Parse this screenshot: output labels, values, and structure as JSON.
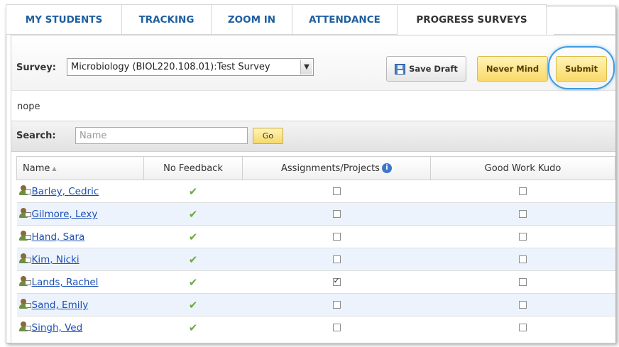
{
  "tabs": [
    {
      "label": "MY STUDENTS",
      "active": false
    },
    {
      "label": "TRACKING",
      "active": false
    },
    {
      "label": "ZOOM IN",
      "active": false
    },
    {
      "label": "ATTENDANCE",
      "active": false
    },
    {
      "label": "PROGRESS SURVEYS",
      "active": true
    }
  ],
  "survey": {
    "label": "Survey:",
    "selected": "Microbiology (BIOL220.108.01):Test Survey"
  },
  "buttons": {
    "save_draft": "Save Draft",
    "never_mind": "Never Mind",
    "submit": "Submit"
  },
  "status_text": "nope",
  "search": {
    "label": "Search:",
    "placeholder": "Name",
    "go_label": "Go"
  },
  "table": {
    "headers": {
      "name": "Name",
      "no_feedback": "No Feedback",
      "assignments": "Assignments/Projects",
      "kudo": "Good Work Kudo"
    },
    "rows": [
      {
        "name": "Barley, Cedric",
        "no_feedback": true,
        "assignments": false,
        "kudo": false
      },
      {
        "name": "Gilmore, Lexy",
        "no_feedback": true,
        "assignments": false,
        "kudo": false
      },
      {
        "name": "Hand, Sara",
        "no_feedback": true,
        "assignments": false,
        "kudo": false
      },
      {
        "name": "Kim, Nicki",
        "no_feedback": true,
        "assignments": false,
        "kudo": false
      },
      {
        "name": "Lands, Rachel",
        "no_feedback": true,
        "assignments": true,
        "kudo": false
      },
      {
        "name": "Sand, Emily",
        "no_feedback": true,
        "assignments": false,
        "kudo": false
      },
      {
        "name": "Singh, Ved",
        "no_feedback": true,
        "assignments": false,
        "kudo": false
      }
    ]
  },
  "colors": {
    "tab_text": "#1f5fa0",
    "link": "#1a4fb4",
    "highlight_ring": "#3d9be0",
    "check": "#6cab3a",
    "alt_row": "#edf3fc"
  }
}
